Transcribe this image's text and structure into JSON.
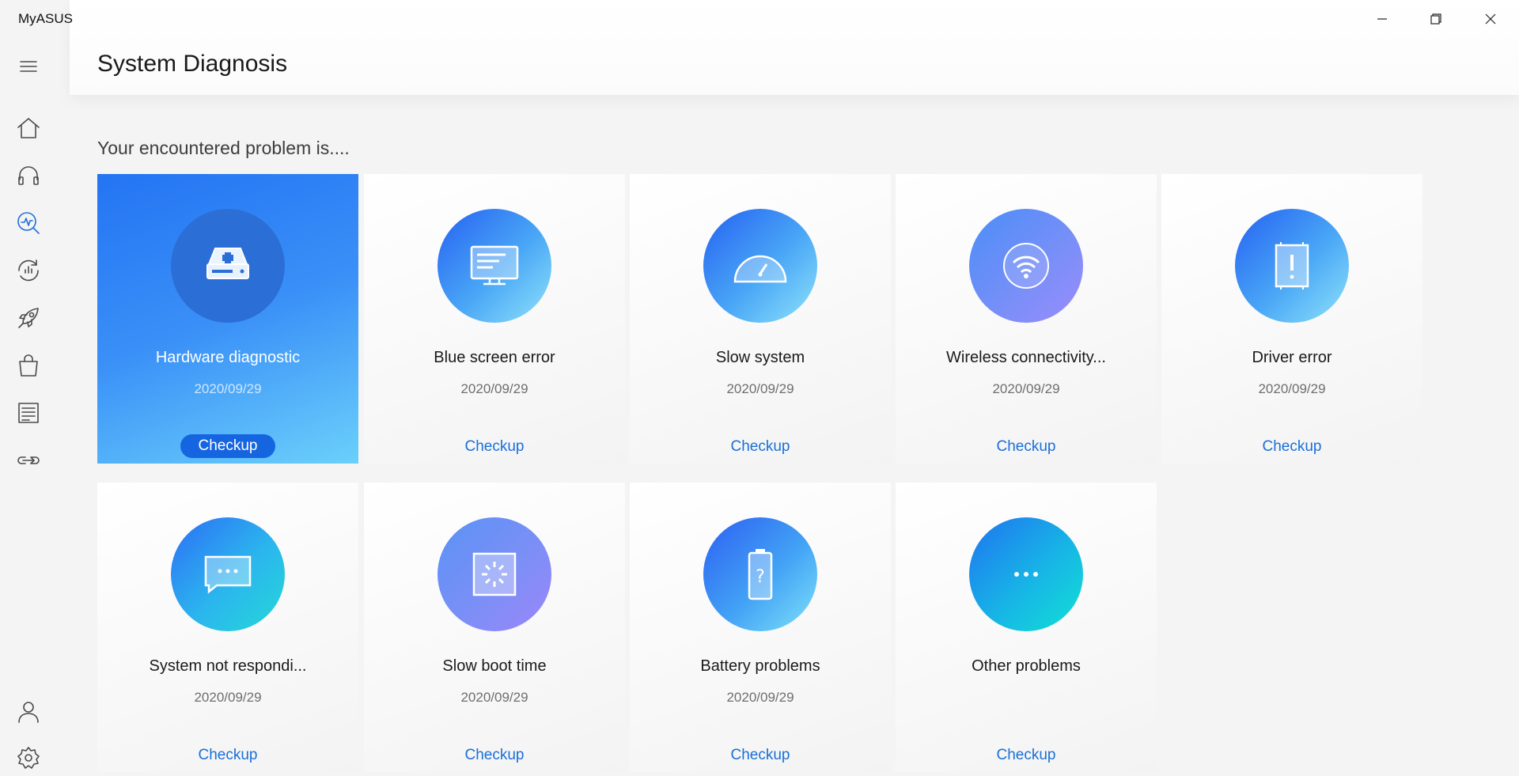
{
  "app": {
    "title": "MyASUS"
  },
  "window_controls": {
    "minimize": "minimize-icon",
    "restore": "restore-icon",
    "close": "close-icon"
  },
  "sidebar": {
    "items": [
      {
        "name": "menu-icon"
      },
      {
        "name": "home-icon"
      },
      {
        "name": "headset-icon"
      },
      {
        "name": "diagnosis-icon",
        "active": true
      },
      {
        "name": "refresh-chart-icon"
      },
      {
        "name": "rocket-icon"
      },
      {
        "name": "shopping-bag-icon"
      },
      {
        "name": "news-icon"
      },
      {
        "name": "link-icon"
      },
      {
        "name": "user-icon"
      },
      {
        "name": "settings-icon"
      }
    ]
  },
  "page": {
    "title": "System Diagnosis",
    "subtitle": "Your encountered problem is...."
  },
  "cards": [
    {
      "label": "Hardware diagnostic",
      "date": "2020/09/29",
      "action": "Checkup",
      "icon": "hardware-drive-icon",
      "selected": true
    },
    {
      "label": "Blue screen error",
      "date": "2020/09/29",
      "action": "Checkup",
      "icon": "monitor-icon"
    },
    {
      "label": "Slow system",
      "date": "2020/09/29",
      "action": "Checkup",
      "icon": "speedometer-icon"
    },
    {
      "label": "Wireless connectivity...",
      "date": "2020/09/29",
      "action": "Checkup",
      "icon": "wifi-icon"
    },
    {
      "label": "Driver error",
      "date": "2020/09/29",
      "action": "Checkup",
      "icon": "driver-chip-icon"
    },
    {
      "label": "System not respondi...",
      "date": "2020/09/29",
      "action": "Checkup",
      "icon": "chat-bubble-icon"
    },
    {
      "label": "Slow boot time",
      "date": "2020/09/29",
      "action": "Checkup",
      "icon": "loading-icon"
    },
    {
      "label": "Battery problems",
      "date": "2020/09/29",
      "action": "Checkup",
      "icon": "battery-icon"
    },
    {
      "label": "Other problems",
      "date": "",
      "action": "Checkup",
      "icon": "more-icon"
    }
  ],
  "colors": {
    "accent": "#1a6fd8",
    "selected_card": "#2b7cf5",
    "background": "#f4f4f5"
  }
}
